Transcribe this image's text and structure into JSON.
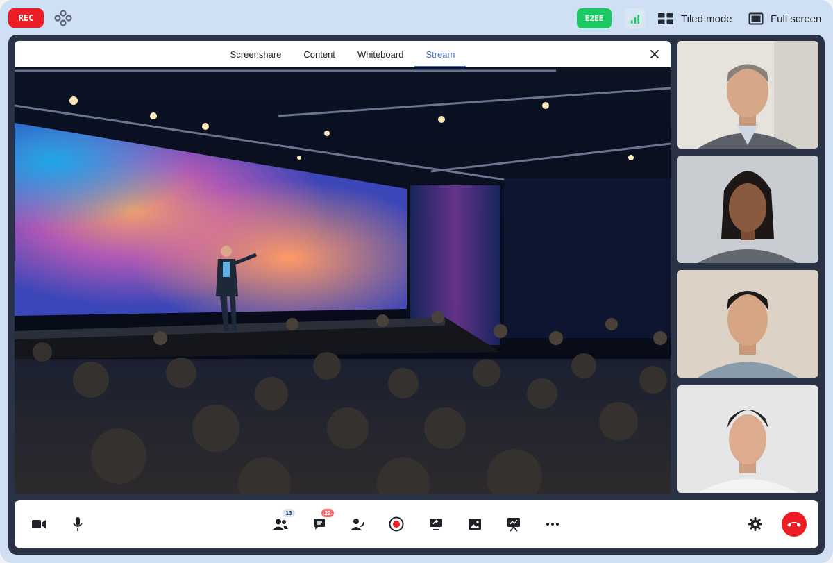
{
  "header": {
    "rec_label": "REC",
    "e2ee_label": "E2EE",
    "tiled_label": "Tiled mode",
    "fullscreen_label": "Full screen"
  },
  "share_tabs": [
    {
      "label": "Screenshare",
      "active": false
    },
    {
      "label": "Content",
      "active": false
    },
    {
      "label": "Whiteboard",
      "active": false
    },
    {
      "label": "Stream",
      "active": true
    }
  ],
  "toolbar": {
    "participants_count": "13",
    "chat_count": "22"
  },
  "colors": {
    "rec": "#ee1c25",
    "e2ee": "#1bc861",
    "accent": "#4b72c9",
    "hangup": "#ee1c25",
    "stage_bg": "#2a3345",
    "frame_bg": "#cfe0f5"
  },
  "icons": [
    "logo-icon",
    "signal-bars-icon",
    "tiled-grid-icon",
    "fullscreen-icon",
    "close-icon",
    "settings-sliders-icon",
    "share-up-icon",
    "expand-icon",
    "camera-icon",
    "microphone-icon",
    "participants-icon",
    "chat-icon",
    "user-speaking-icon",
    "record-icon",
    "screen-share-icon",
    "image-icon",
    "presentation-icon",
    "more-icon",
    "gear-icon",
    "hang-up-icon"
  ]
}
